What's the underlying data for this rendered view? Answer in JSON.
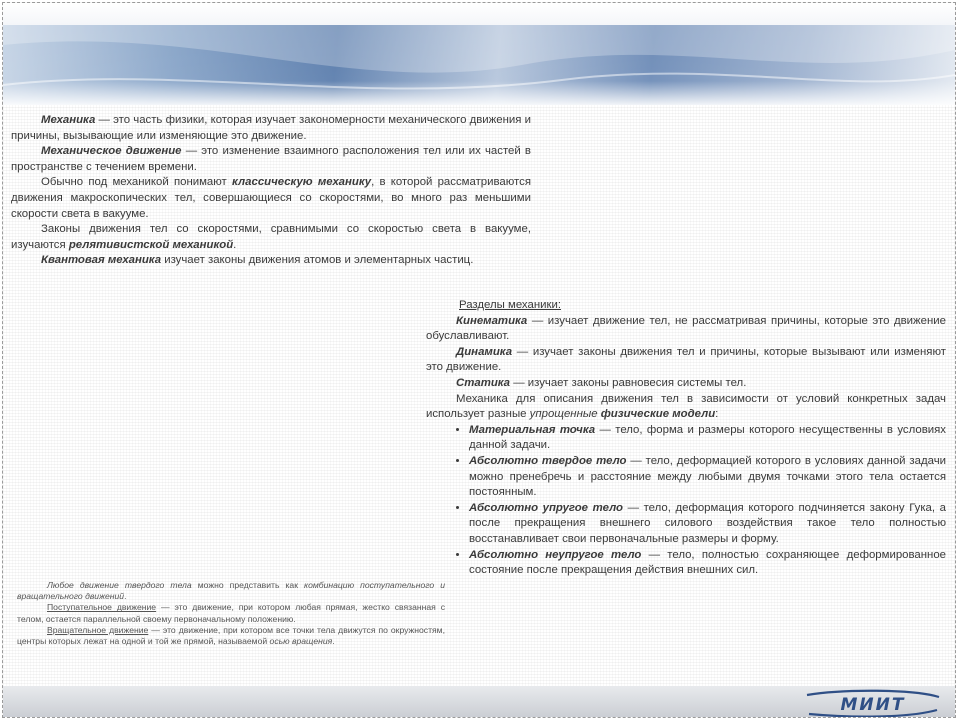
{
  "intro": {
    "p1_term": "Механика",
    "p1_rest": " — это часть физики, которая изучает закономерности механического движения и причины, вызывающие или изменяющие это движение.",
    "p2_term": "Механическое движение",
    "p2_rest": " — это изменение взаимного расположения тел или их частей в пространстве с течением времени.",
    "p3_start": "Обычно под механикой понимают ",
    "p3_term": "классическую механику",
    "p3_rest": ", в которой рассматриваются движения макроскопических тел, совершающиеся со скоростями, во много раз меньшими скорости света в вакууме.",
    "p4_start": "Законы движения тел со скоростями, сравнимыми со скоростью света в вакууме, изучаются ",
    "p4_term": "релятивистской механикой",
    "p4_end": ".",
    "p5_term": "Квантовая механика",
    "p5_rest": " изучает законы движения атомов и элементарных частиц."
  },
  "sections": {
    "title": "Разделы механики:",
    "kin_term": "Кинематика",
    "kin_rest": " — изучает движение тел, не рассматривая причины, которые это движение обуславливают.",
    "dyn_term": "Динамика",
    "dyn_rest": " — изучает законы движения тел и причины, которые вызывают или изменяют это движение.",
    "stat_term": "Статика",
    "stat_rest": " — изучает законы равновесия системы тел.",
    "models_start": "Механика для описания движения тел в зависимости от условий конкретных задач использует разные ",
    "models_em": "упрощенные ",
    "models_term": "физические модели",
    "models_end": ":",
    "items": [
      {
        "term": "Материальная точка",
        "rest": " — тело, форма и размеры которого несущественны в условиях данной задачи."
      },
      {
        "term": "Абсолютно твердое тело",
        "rest": " — тело, деформацией которого в условиях данной задачи можно пренебречь и расстояние между любыми двумя точками этого тела остается постоянным."
      },
      {
        "term": "Абсолютно упругое тело",
        "rest": " — тело, деформация которого подчиняется закону Гука, а после прекращения внешнего силового воздействия такое тело полностью восстанавливает свои первоначальные размеры и форму."
      },
      {
        "term": "Абсолютно неупругое тело",
        "rest": " — тело, полностью сохраняющее деформированное состояние после прекращения действия внешних сил."
      }
    ]
  },
  "note": {
    "n1_em1": "Любое движение твердого тела",
    "n1_mid": " можно представить как ",
    "n1_em2": "комбинацию поступательного и вращательного движений",
    "n1_end": ".",
    "n2_term": "Поступательное движение",
    "n2_rest": " — это движение, при котором любая прямая, жестко связанная с телом, остается параллельной своему первоначальному положению.",
    "n3_term": "Вращательное движение",
    "n3_rest": " — это движение, при котором все точки тела движутся по окружностям, центры которых лежат на одной и той же прямой, называемой ",
    "n3_em": "осью вращения",
    "n3_end": "."
  },
  "logo": {
    "text": "МИИТ",
    "color": "#2f4f86"
  }
}
